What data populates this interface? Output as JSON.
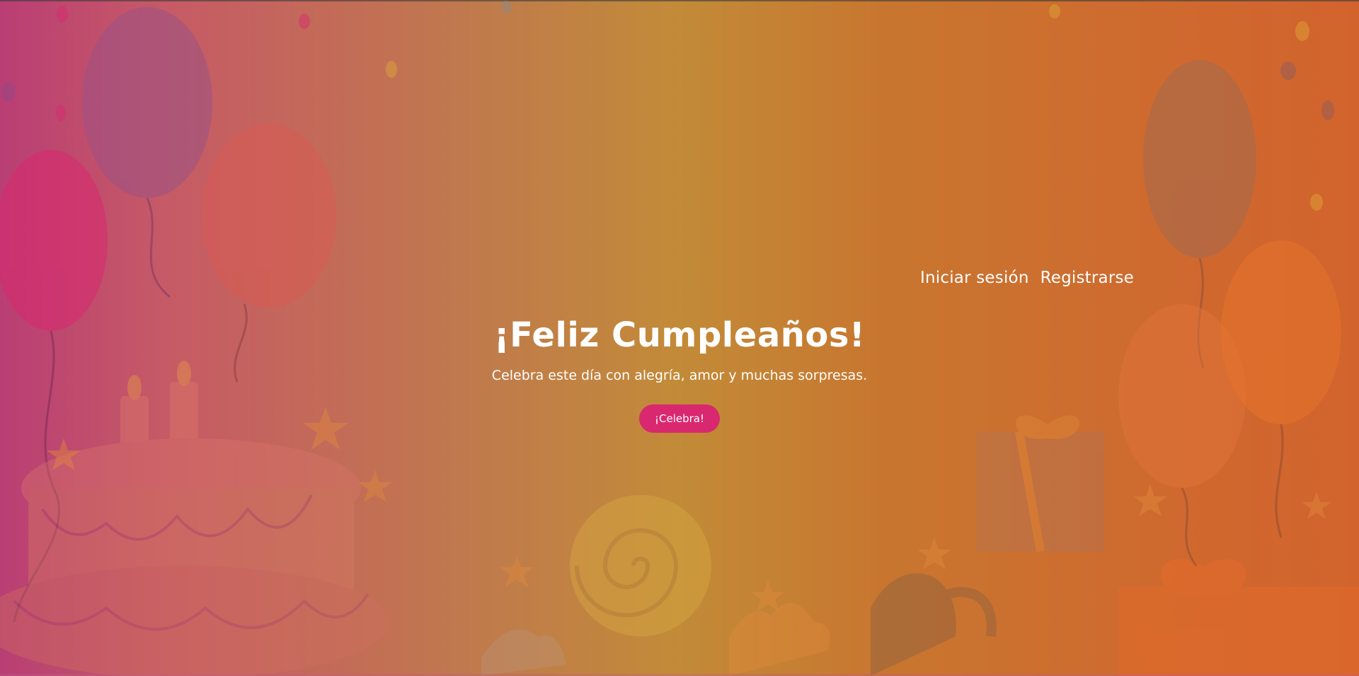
{
  "nav": {
    "login_label": "Iniciar sesión",
    "register_label": "Registrarse"
  },
  "hero": {
    "title": "¡Feliz Cumpleaños!",
    "subtitle": "Celebra este día con alegría, amor y muchas sorpresas.",
    "cta_label": "¡Celebra!"
  },
  "colors": {
    "accent": "#d9286f",
    "gradient_left": "#b93e74",
    "gradient_mid": "#c28b38",
    "gradient_right": "#d2632d"
  },
  "icons": [
    "balloon",
    "birthday-cake",
    "gift-box",
    "lollipop",
    "cupcake",
    "star",
    "confetti"
  ]
}
